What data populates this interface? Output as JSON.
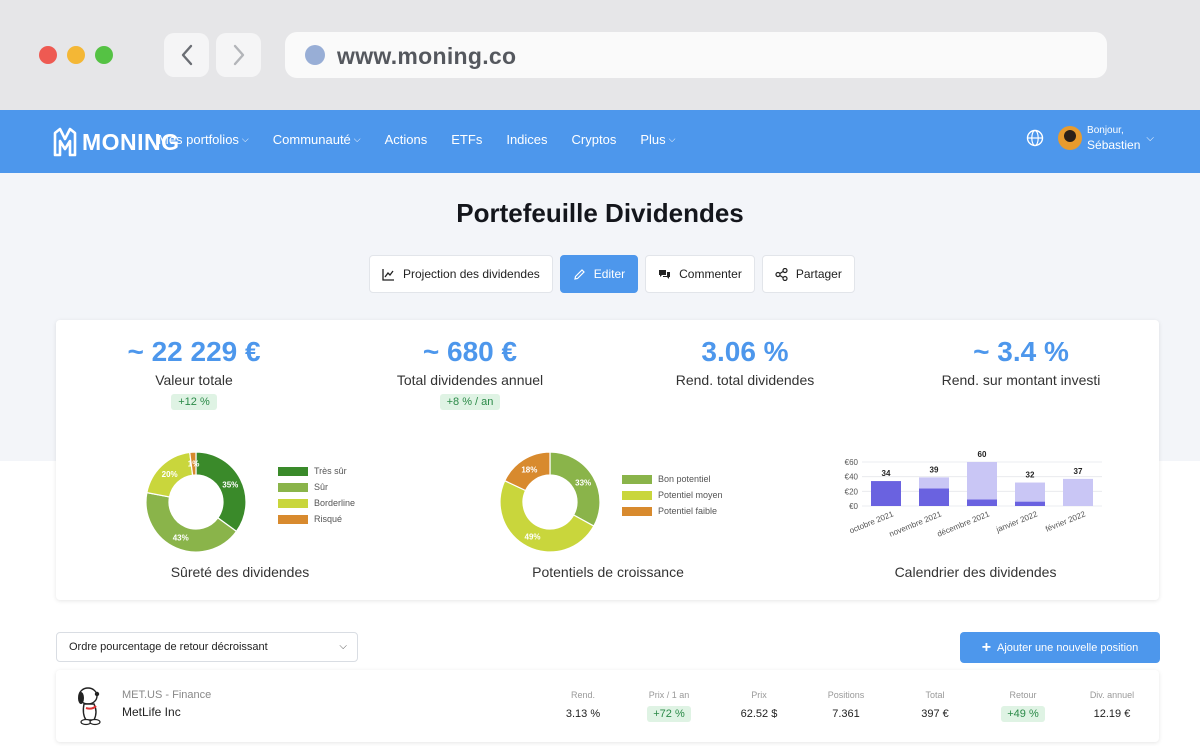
{
  "browser": {
    "url": "www.moning.co"
  },
  "nav": {
    "logo": "MONING",
    "links": [
      {
        "label": "Mes portfolios",
        "dropdown": true
      },
      {
        "label": "Communauté",
        "dropdown": true
      },
      {
        "label": "Actions",
        "dropdown": false
      },
      {
        "label": "ETFs",
        "dropdown": false
      },
      {
        "label": "Indices",
        "dropdown": false
      },
      {
        "label": "Cryptos",
        "dropdown": false
      },
      {
        "label": "Plus",
        "dropdown": true
      }
    ],
    "user": {
      "greeting": "Bonjour,",
      "name": "Sébastien"
    }
  },
  "page": {
    "title": "Portefeuille Dividendes",
    "actions": {
      "projection": "Projection des dividendes",
      "edit": "Editer",
      "comment": "Commenter",
      "share": "Partager"
    }
  },
  "stats": [
    {
      "value": "~ 22 229 €",
      "label": "Valeur totale",
      "badge": "+12 %"
    },
    {
      "value": "~ 680 €",
      "label": "Total dividendes annuel",
      "badge": "+8 % / an"
    },
    {
      "value": "3.06 %",
      "label": "Rend. total dividendes",
      "badge": ""
    },
    {
      "value": "~ 3.4 %",
      "label": "Rend. sur montant investi",
      "badge": ""
    }
  ],
  "chart_data": [
    {
      "type": "pie",
      "title": "Sûreté des dividendes",
      "donut": true,
      "legend_position": "right",
      "labels": [
        "Très sûr",
        "Sûr",
        "Borderline",
        "Risqué"
      ],
      "values": [
        35,
        43,
        20,
        2
      ],
      "value_labels": [
        "35%",
        "43%",
        "20%",
        "1%"
      ],
      "colors": [
        "#3a8a2a",
        "#8ab44a",
        "#c9d63c",
        "#d88a2e"
      ]
    },
    {
      "type": "pie",
      "title": "Potentiels de croissance",
      "donut": true,
      "legend_position": "right",
      "labels": [
        "Bon potentiel",
        "Potentiel moyen",
        "Potentiel faible"
      ],
      "values": [
        33,
        49,
        18
      ],
      "value_labels": [
        "33%",
        "49%",
        "18%"
      ],
      "colors": [
        "#8ab44a",
        "#c9d63c",
        "#d88a2e"
      ]
    },
    {
      "type": "bar",
      "title": "Calendrier des dividendes",
      "categories": [
        "octobre 2021",
        "novembre 2021",
        "décembre 2021",
        "janvier 2022",
        "février 2022"
      ],
      "stacked": true,
      "series": [
        {
          "values": [
            34,
            24,
            9,
            6,
            0
          ]
        },
        {
          "values": [
            0,
            15,
            51,
            26,
            37
          ]
        }
      ],
      "totals": [
        34,
        39,
        60,
        32,
        37
      ],
      "y_ticks": [
        "€0",
        "€20",
        "€40",
        "€60"
      ],
      "ylim": [
        0,
        60
      ],
      "colors": [
        "#6a62e0",
        "#c9c6f5"
      ]
    }
  ],
  "controls": {
    "sort": "Ordre pourcentage de retour décroissant",
    "add": "Ajouter une nouvelle position"
  },
  "position": {
    "ticker": "MET.US - Finance",
    "name": "MetLife Inc",
    "columns": [
      {
        "header": "Rend.",
        "value": "3.13 %",
        "pill": false
      },
      {
        "header": "Prix / 1 an",
        "value": "+72 %",
        "pill": true
      },
      {
        "header": "Prix",
        "value": "62.52 $",
        "pill": false
      },
      {
        "header": "Positions",
        "value": "7.361",
        "pill": false
      },
      {
        "header": "Total",
        "value": "397 €",
        "pill": false
      },
      {
        "header": "Retour",
        "value": "+49 %",
        "pill": true
      },
      {
        "header": "Div. annuel",
        "value": "12.19 €",
        "pill": false
      }
    ]
  }
}
